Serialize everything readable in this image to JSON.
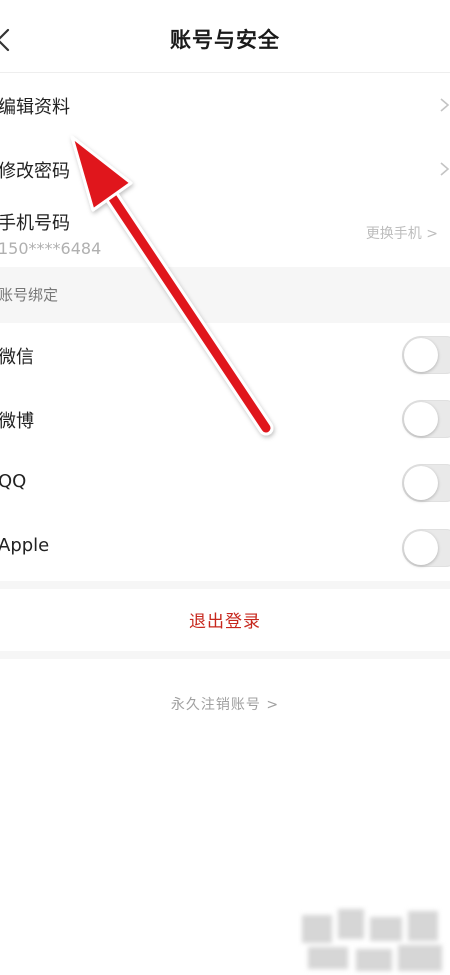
{
  "header": {
    "title": "账号与安全",
    "back_icon": "chevron-left-icon"
  },
  "profile": {
    "edit_profile_label": "编辑资料",
    "change_password_label": "修改密码",
    "phone_label": "手机号码",
    "phone_value": "150****6484",
    "change_phone_label": "更换手机 >"
  },
  "binding": {
    "section_title": "账号绑定",
    "items": [
      {
        "label": "微信",
        "enabled": false
      },
      {
        "label": "微博",
        "enabled": false
      },
      {
        "label": "QQ",
        "enabled": false
      },
      {
        "label": "Apple",
        "enabled": false
      }
    ]
  },
  "actions": {
    "logout_label": "退出登录",
    "delete_account_label": "永久注销账号 >"
  },
  "colors": {
    "accent_red": "#c7271d",
    "arrow_red": "#e0141e",
    "section_bg": "#f6f6f6",
    "toggle_off": "#e9e9e9"
  }
}
